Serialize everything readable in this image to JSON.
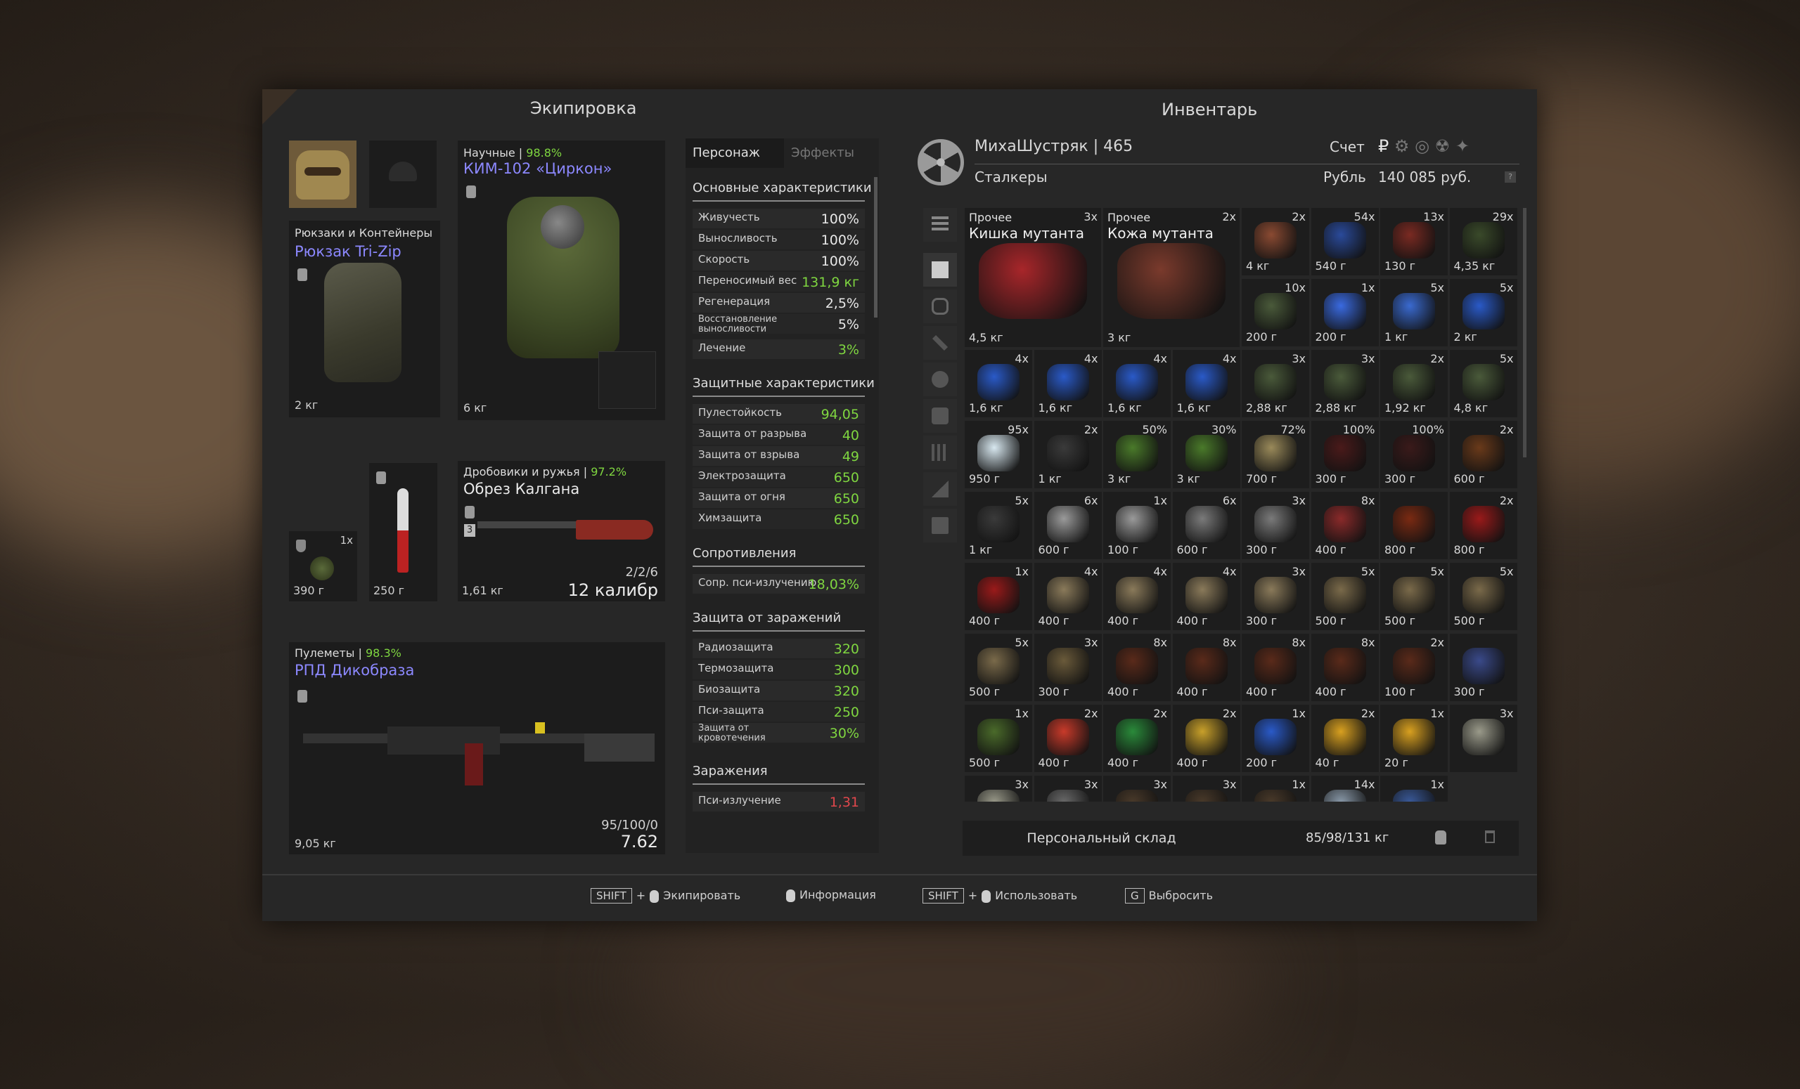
{
  "equipment": {
    "title": "Экипировка",
    "backpack": {
      "category": "Рюкзаки и Контейнеры",
      "name": "Рюкзак Tri-Zip",
      "weight": "2 кг"
    },
    "armor": {
      "category": "Научные",
      "condition": "98.8%",
      "name": "КИМ-102 «Циркон»",
      "weight": "6 кг"
    },
    "grenade": {
      "count": "1x",
      "weight": "390 г"
    },
    "knife": {
      "weight": "250 г"
    },
    "shotgun": {
      "category": "Дробовики и ружья",
      "condition": "97.2%",
      "name": "Обрез Калгана",
      "weight": "1,61 кг",
      "ammo": "2/2/6",
      "caliber": "12 калибр",
      "mod_badge": "3"
    },
    "mg": {
      "category": "Пулеметы",
      "condition": "98.3%",
      "name": "РПД Дикобраза",
      "weight": "9,05 кг",
      "ammo": "95/100/0",
      "caliber": "7.62"
    }
  },
  "stats": {
    "tabs": [
      "Персонаж",
      "Эффекты"
    ],
    "sections": [
      {
        "title": "Основные характеристики",
        "rows": [
          {
            "k": "Живучесть",
            "v": "100%",
            "color": "#e8e8e8"
          },
          {
            "k": "Выносливость",
            "v": "100%",
            "color": "#e8e8e8"
          },
          {
            "k": "Скорость",
            "v": "100%",
            "color": "#e8e8e8"
          },
          {
            "k": "Переносимый вес",
            "v": "131,9 кг",
            "color": "#7fd640"
          },
          {
            "k": "Регенерация",
            "v": "2,5%",
            "color": "#e8e8e8"
          },
          {
            "k": "Восстановление выносливости",
            "v": "5%",
            "color": "#e8e8e8"
          },
          {
            "k": "Лечение",
            "v": "3%",
            "color": "#7fd640"
          }
        ]
      },
      {
        "title": "Защитные характеристики",
        "rows": [
          {
            "k": "Пулестойкость",
            "v": "94,05",
            "color": "#7fd640"
          },
          {
            "k": "Защита от разрыва",
            "v": "40",
            "color": "#7fd640"
          },
          {
            "k": "Защита от взрыва",
            "v": "49",
            "color": "#7fd640"
          },
          {
            "k": "Электрозащита",
            "v": "650",
            "color": "#7fd640"
          },
          {
            "k": "Защита от огня",
            "v": "650",
            "color": "#7fd640"
          },
          {
            "k": "Химзащита",
            "v": "650",
            "color": "#7fd640"
          }
        ]
      },
      {
        "title": "Сопротивления",
        "rows": [
          {
            "k": "Сопр. пси-излучению",
            "v": "18,03%",
            "color": "#7fd640"
          }
        ]
      },
      {
        "title": "Защита от заражений",
        "rows": [
          {
            "k": "Радиозащита",
            "v": "320",
            "color": "#7fd640"
          },
          {
            "k": "Термозащита",
            "v": "300",
            "color": "#7fd640"
          },
          {
            "k": "Биозащита",
            "v": "320",
            "color": "#7fd640"
          },
          {
            "k": "Пси-защита",
            "v": "250",
            "color": "#7fd640"
          },
          {
            "k": "Защита от кровотечения",
            "v": "30%",
            "color": "#7fd640"
          }
        ]
      },
      {
        "title": "Заражения",
        "rows": [
          {
            "k": "Пси-излучение",
            "v": "1,31",
            "color": "#e0474c"
          }
        ]
      }
    ]
  },
  "inventory": {
    "title": "Инвентарь",
    "player": "МихаШустряк | 465",
    "faction": "Сталкеры",
    "account_label": "Счет",
    "currency_label": "Рубль",
    "balance": "140 085 руб.",
    "storage_label": "Персональный склад",
    "weight_status": "85/98/131 кг",
    "items": [
      {
        "label": "Прочее",
        "name": "Кишка мутанта",
        "c": "3x",
        "w": "4,5 кг",
        "color": "#a8262a",
        "big": true
      },
      {
        "label": "Прочее",
        "name": "Кожа мутанта",
        "c": "2x",
        "w": "3 кг",
        "color": "#7a3a2c",
        "big": true
      },
      {
        "c": "2x",
        "w": "4 кг",
        "color": "#8a4a32"
      },
      {
        "c": "54x",
        "w": "540 г",
        "color": "#2a4a9a"
      },
      {
        "c": "13x",
        "w": "130 г",
        "color": "#7a2a22"
      },
      {
        "c": "29x",
        "w": "4,35 кг",
        "color": "#3a4a2a"
      },
      {
        "c": "10x",
        "w": "200 г",
        "color": "#4a5a3a"
      },
      {
        "c": "1x",
        "w": "200 г",
        "color": "#3a6ae0"
      },
      {
        "c": "5x",
        "w": "1 кг",
        "color": "#3a6ad0"
      },
      {
        "c": "5x",
        "w": "2 кг",
        "color": "#2a5ac8"
      },
      {
        "c": "4x",
        "w": "1,6 кг",
        "color": "#2a5ac8"
      },
      {
        "c": "4x",
        "w": "1,6 кг",
        "color": "#2a5ac8"
      },
      {
        "c": "4x",
        "w": "1,6 кг",
        "color": "#2a5ac8"
      },
      {
        "c": "4x",
        "w": "1,6 кг",
        "color": "#2a5ac8"
      },
      {
        "c": "3x",
        "w": "2,88 кг",
        "color": "#4a5a3a"
      },
      {
        "c": "3x",
        "w": "2,88 кг",
        "color": "#4a5a3a"
      },
      {
        "c": "2x",
        "w": "1,92 кг",
        "color": "#4a5a3a"
      },
      {
        "c": "5x",
        "w": "4,8 кг",
        "color": "#4a5a3a"
      },
      {
        "c": "95x",
        "w": "950 г",
        "color": "#d8e8f0"
      },
      {
        "c": "2x",
        "w": "1 кг",
        "color": "#3a3a3a"
      },
      {
        "c": "50%",
        "w": "3 кг",
        "color": "#4a7a2a"
      },
      {
        "c": "30%",
        "w": "3 кг",
        "color": "#4a7a2a"
      },
      {
        "c": "72%",
        "w": "700 г",
        "color": "#9a8a5a"
      },
      {
        "c": "100%",
        "w": "300 г",
        "color": "#4a1a1a"
      },
      {
        "c": "100%",
        "w": "300 г",
        "color": "#3a1a1a"
      },
      {
        "c": "2x",
        "w": "600 г",
        "color": "#6a3a1a"
      },
      {
        "c": "5x",
        "w": "1 кг",
        "color": "#3a3a3a"
      },
      {
        "c": "6x",
        "w": "600 г",
        "color": "#9a9a9a"
      },
      {
        "c": "1x",
        "w": "100 г",
        "color": "#9a9a9a"
      },
      {
        "c": "6x",
        "w": "600 г",
        "color": "#7a7a7a"
      },
      {
        "c": "3x",
        "w": "300 г",
        "color": "#7a7a7a"
      },
      {
        "c": "8x",
        "w": "400 г",
        "color": "#8a2a2a"
      },
      {
        "c": "",
        "w": "800 г",
        "color": "#7a2a12"
      },
      {
        "c": "2x",
        "w": "800 г",
        "color": "#9a1a1a"
      },
      {
        "c": "1x",
        "w": "400 г",
        "color": "#9a1a1a"
      },
      {
        "c": "4x",
        "w": "400 г",
        "color": "#8a7a5a"
      },
      {
        "c": "4x",
        "w": "400 г",
        "color": "#8a7a5a"
      },
      {
        "c": "4x",
        "w": "400 г",
        "color": "#8a7a5a"
      },
      {
        "c": "3x",
        "w": "300 г",
        "color": "#8a7a5a"
      },
      {
        "c": "5x",
        "w": "500 г",
        "color": "#7a6a4a"
      },
      {
        "c": "5x",
        "w": "500 г",
        "color": "#7a6a4a"
      },
      {
        "c": "5x",
        "w": "500 г",
        "color": "#7a6a4a"
      },
      {
        "c": "5x",
        "w": "500 г",
        "color": "#7a6a4a"
      },
      {
        "c": "3x",
        "w": "300 г",
        "color": "#6a5a3a"
      },
      {
        "c": "8x",
        "w": "400 г",
        "color": "#5a2a1a"
      },
      {
        "c": "8x",
        "w": "400 г",
        "color": "#5a2a1a"
      },
      {
        "c": "8x",
        "w": "400 г",
        "color": "#5a2a1a"
      },
      {
        "c": "8x",
        "w": "400 г",
        "color": "#5a2a1a"
      },
      {
        "c": "2x",
        "w": "100 г",
        "color": "#5a2a1a"
      },
      {
        "c": "",
        "w": "300 г",
        "color": "#3a4a8a"
      },
      {
        "c": "1x",
        "w": "500 г",
        "color": "#4a6a2a"
      },
      {
        "c": "2x",
        "w": "400 г",
        "color": "#c83a2a"
      },
      {
        "c": "2x",
        "w": "400 г",
        "color": "#2a8a3a"
      },
      {
        "c": "2x",
        "w": "400 г",
        "color": "#c8a02a"
      },
      {
        "c": "1x",
        "w": "200 г",
        "color": "#2a5ac8"
      },
      {
        "c": "2x",
        "w": "40 г",
        "color": "#d8a020"
      },
      {
        "c": "1x",
        "w": "20 г",
        "color": "#d8a020"
      },
      {
        "c": "3x",
        "w": "",
        "color": "#9a9a8a"
      },
      {
        "c": "3x",
        "w": "",
        "color": "#9a9a8a"
      },
      {
        "c": "3x",
        "w": "",
        "color": "#6a6a6a"
      },
      {
        "c": "3x",
        "w": "",
        "color": "#4a3a2a"
      },
      {
        "c": "3x",
        "w": "",
        "color": "#4a3a2a"
      },
      {
        "c": "1x",
        "w": "",
        "color": "#4a3a2a"
      },
      {
        "c": "14x",
        "w": "",
        "color": "#8a9aaa"
      },
      {
        "c": "1x",
        "w": "",
        "color": "#3a5a9a"
      }
    ]
  },
  "footer": {
    "equip_key": "SHIFT",
    "equip_label": "Экипировать",
    "info_label": "Информация",
    "use_key": "SHIFT",
    "use_label": "Использовать",
    "drop_key": "G",
    "drop_label": "Выбросить"
  },
  "colors": {
    "accent_green": "#7fd640",
    "item_name_purple": "#8c88ff",
    "negative_red": "#e0474c"
  }
}
